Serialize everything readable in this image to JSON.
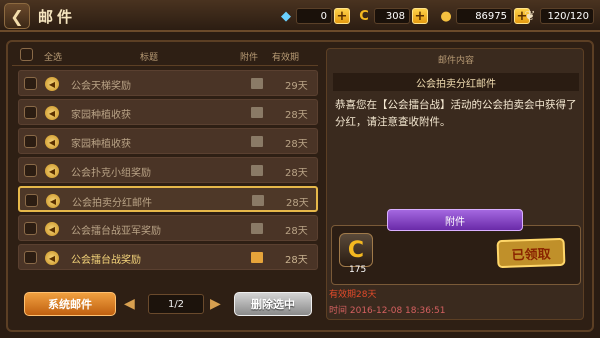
{
  "topbar": {
    "back_icon": "back-arrow-icon",
    "title": "邮件",
    "resources": [
      {
        "name": "diamond",
        "icon": "diamond-icon",
        "value": "0"
      },
      {
        "name": "coupon",
        "icon": "c-coin-icon",
        "value": "308"
      },
      {
        "name": "gold",
        "icon": "gold-coin-icon",
        "value": "86975"
      },
      {
        "name": "stamina",
        "icon": "wing-icon",
        "value": "120/120"
      }
    ]
  },
  "list": {
    "header": {
      "select_all": "全选",
      "title": "标题",
      "attachment": "附件",
      "validity": "有效期"
    },
    "rows": [
      {
        "title": "公会天梯奖励",
        "days": "29天",
        "fresh": false,
        "selected": false
      },
      {
        "title": "家园种植收获",
        "days": "28天",
        "fresh": false,
        "selected": false
      },
      {
        "title": "家园种植收获",
        "days": "28天",
        "fresh": false,
        "selected": false
      },
      {
        "title": "公会扑克小组奖励",
        "days": "28天",
        "fresh": false,
        "selected": false
      },
      {
        "title": "公会拍卖分红邮件",
        "days": "28天",
        "fresh": false,
        "selected": true
      },
      {
        "title": "公会擂台战亚军奖励",
        "days": "28天",
        "fresh": false,
        "selected": false
      },
      {
        "title": "公会擂台战奖励",
        "days": "28天",
        "fresh": true,
        "selected": false
      }
    ]
  },
  "footer": {
    "system_mail": "系统邮件",
    "page": "1/2",
    "delete_selected": "删除选中"
  },
  "detail": {
    "header": "邮件内容",
    "subject": "公会拍卖分红邮件",
    "body": "恭喜您在【公会擂台战】活动的公会拍卖会中获得了分红，请注意查收附件。",
    "attachment_label": "附件",
    "item": {
      "icon": "c-coin-icon",
      "qty": "175"
    },
    "claimed": "已领取",
    "expire": "有效期28天",
    "time": "时间 2016-12-08 18:36:51"
  }
}
